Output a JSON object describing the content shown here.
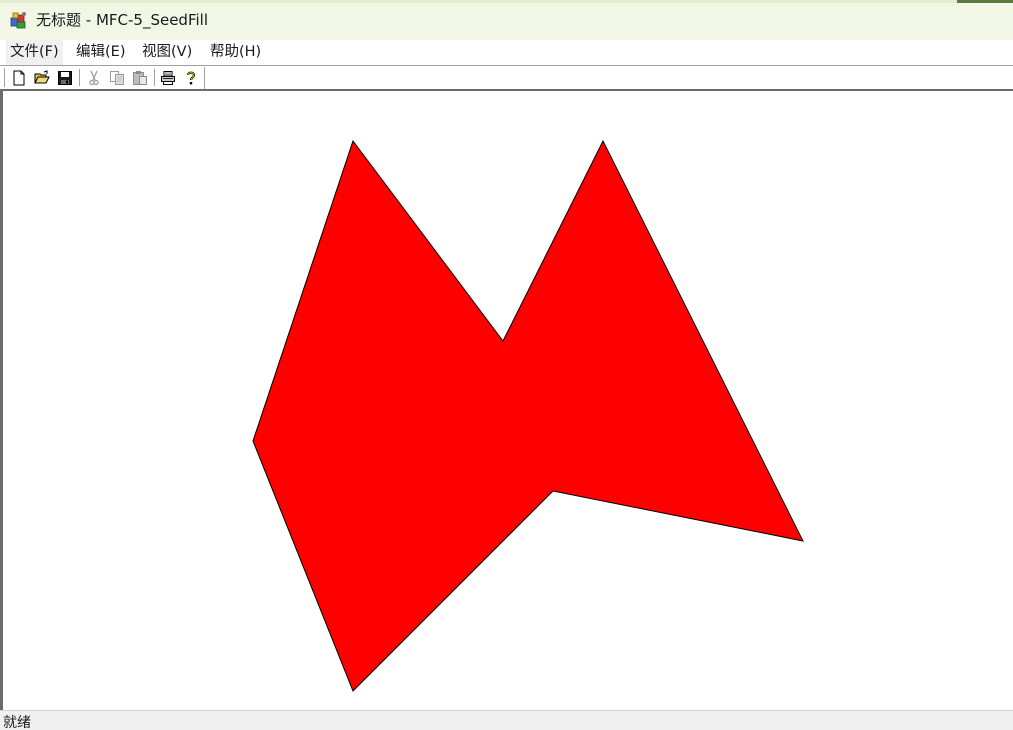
{
  "window": {
    "title": "无标题 - MFC-5_SeedFill",
    "app_icon": "mfc-app-icon"
  },
  "menu": {
    "items": [
      {
        "label": "文件(F)"
      },
      {
        "label": "编辑(E)"
      },
      {
        "label": "视图(V)"
      },
      {
        "label": "帮助(H)"
      }
    ]
  },
  "toolbar": {
    "buttons": [
      {
        "icon": "new-document-icon",
        "enabled": true
      },
      {
        "icon": "open-folder-icon",
        "enabled": true
      },
      {
        "icon": "save-disk-icon",
        "enabled": true
      },
      {
        "icon": "cut-scissors-icon",
        "enabled": false
      },
      {
        "icon": "copy-icon",
        "enabled": false
      },
      {
        "icon": "paste-icon",
        "enabled": false
      },
      {
        "icon": "print-icon",
        "enabled": true
      },
      {
        "icon": "help-about-icon",
        "enabled": true
      }
    ]
  },
  "canvas": {
    "fill_color": "#ff0000",
    "outline_color": "#000000",
    "background": "#ffffff"
  },
  "status": {
    "text": "就绪"
  }
}
